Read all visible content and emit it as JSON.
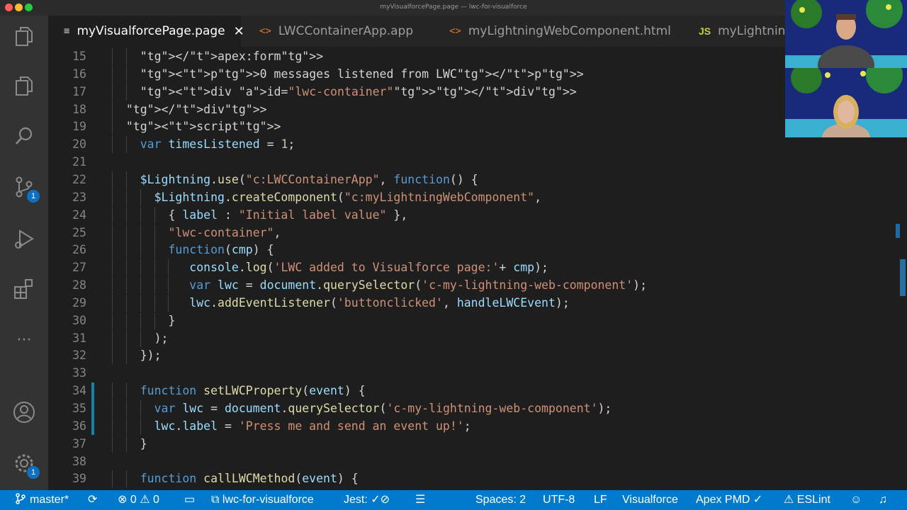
{
  "window": {
    "title": "myVisualforcePage.page — lwc-for-visualforce"
  },
  "tabs": [
    {
      "label": "myVisualforcePage.page",
      "icon": "lines-icon"
    },
    {
      "label": "LWCContainerApp.app",
      "icon": "code-brackets-icon"
    },
    {
      "label": "myLightningWebComponent.html",
      "icon": "code-brackets-icon"
    },
    {
      "label": "myLightning",
      "icon": "js-icon"
    }
  ],
  "activity_bar": {
    "source_control_badge": "1",
    "settings_badge": "1"
  },
  "code_lines": [
    {
      "num": "15",
      "text": "    </apex:form>"
    },
    {
      "num": "16",
      "text": "    <p>0 messages listened from LWC</p>"
    },
    {
      "num": "17",
      "text": "    <div id=\"lwc-container\"></div>"
    },
    {
      "num": "18",
      "text": "  </div>"
    },
    {
      "num": "19",
      "text": "  <script>"
    },
    {
      "num": "20",
      "text": "    var timesListened = 1;"
    },
    {
      "num": "21",
      "text": ""
    },
    {
      "num": "22",
      "text": "    $Lightning.use(\"c:LWCContainerApp\", function() {"
    },
    {
      "num": "23",
      "text": "      $Lightning.createComponent(\"c:myLightningWebComponent\","
    },
    {
      "num": "24",
      "text": "        { label : \"Initial label value\" },"
    },
    {
      "num": "25",
      "text": "        \"lwc-container\","
    },
    {
      "num": "26",
      "text": "        function(cmp) {"
    },
    {
      "num": "27",
      "text": "           console.log('LWC added to Visualforce page:'+ cmp);"
    },
    {
      "num": "28",
      "text": "           var lwc = document.querySelector('c-my-lightning-web-component');"
    },
    {
      "num": "29",
      "text": "           lwc.addEventListener('buttonclicked', handleLWCEvent);"
    },
    {
      "num": "30",
      "text": "        }"
    },
    {
      "num": "31",
      "text": "      );"
    },
    {
      "num": "32",
      "text": "    });"
    },
    {
      "num": "33",
      "text": ""
    },
    {
      "num": "34",
      "text": "    function setLWCProperty(event) {"
    },
    {
      "num": "35",
      "text": "      var lwc = document.querySelector('c-my-lightning-web-component');"
    },
    {
      "num": "36",
      "text": "      lwc.label = 'Press me and send an event up!';"
    },
    {
      "num": "37",
      "text": "    }"
    },
    {
      "num": "38",
      "text": ""
    },
    {
      "num": "39",
      "text": "    function callLWCMethod(event) {"
    }
  ],
  "status_bar": {
    "branch": "master*",
    "errors": "0",
    "warnings": "0",
    "project": "lwc-for-visualforce",
    "jest": "Jest:",
    "spaces": "Spaces: 2",
    "encoding": "UTF-8",
    "eol": "LF",
    "language": "Visualforce",
    "pmd": "Apex PMD",
    "eslint": "ESLint"
  },
  "colors": {
    "status_bar": "#007acc",
    "editor_bg": "#1e1e1e",
    "activity_bg": "#333333",
    "tab_bar_bg": "#252526"
  }
}
